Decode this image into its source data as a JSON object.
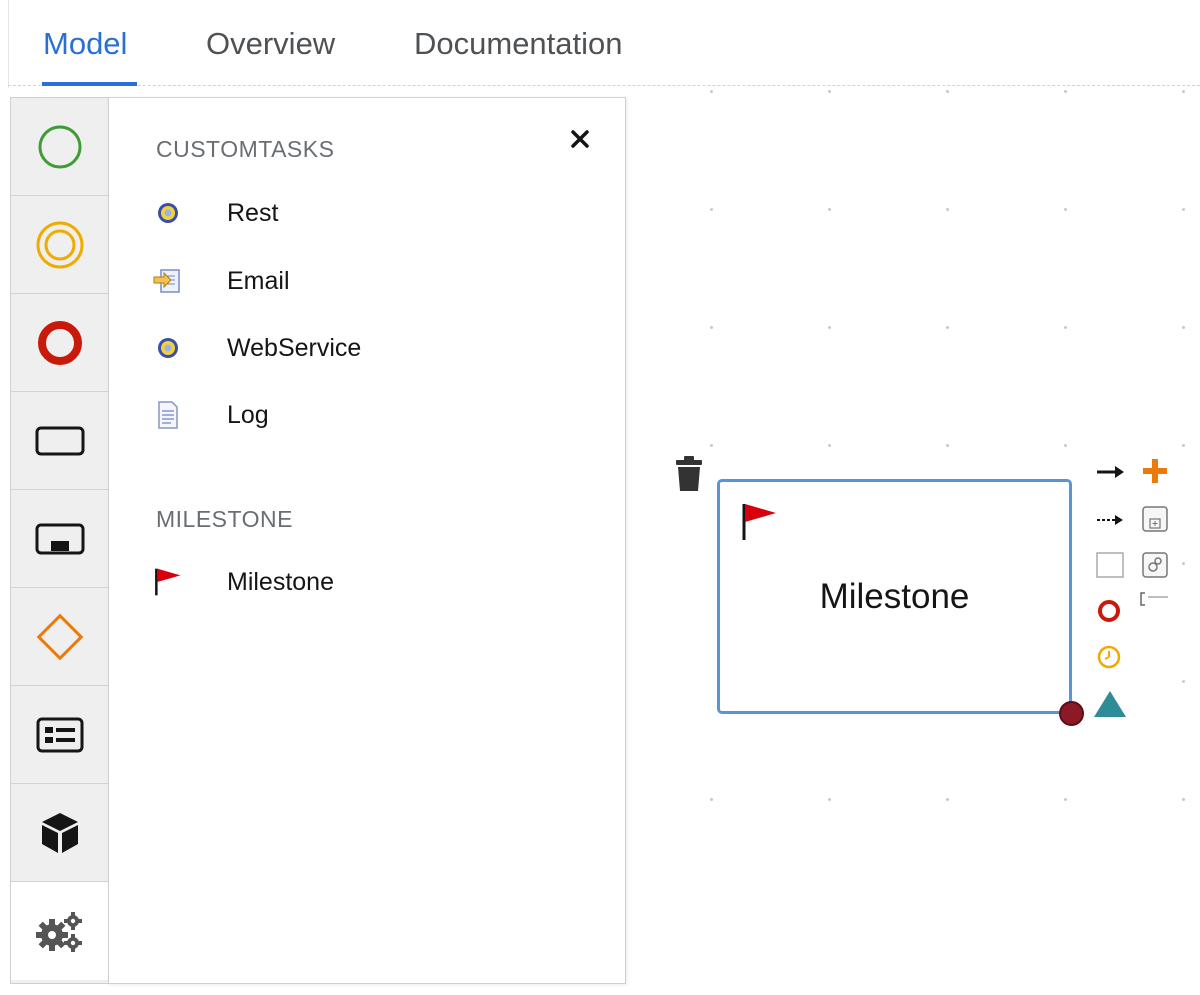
{
  "tabs": [
    {
      "label": "Model",
      "active": true
    },
    {
      "label": "Overview",
      "active": false
    },
    {
      "label": "Documentation",
      "active": false
    }
  ],
  "palette": {
    "buttons": [
      {
        "icon": "start-event-icon",
        "color": "#3f9c35"
      },
      {
        "icon": "intermediate-event-icon",
        "color": "#f0ab00"
      },
      {
        "icon": "end-event-icon",
        "color": "#c9190b"
      },
      {
        "icon": "task-icon",
        "color": "#151515"
      },
      {
        "icon": "subprocess-icon",
        "color": "#151515"
      },
      {
        "icon": "gateway-icon",
        "color": "#ec7a08"
      },
      {
        "icon": "container-icon",
        "color": "#151515"
      },
      {
        "icon": "cube-icon",
        "color": "#151515"
      },
      {
        "icon": "gears-icon",
        "color": "#151515",
        "selected": true
      }
    ]
  },
  "flyout": {
    "close_label": "×",
    "sections": [
      {
        "title": "CUSTOMTASKS",
        "items": [
          {
            "label": "Rest",
            "icon": "rest-gear-icon"
          },
          {
            "label": "Email",
            "icon": "email-icon"
          },
          {
            "label": "WebService",
            "icon": "webservice-gear-icon"
          },
          {
            "label": "Log",
            "icon": "log-document-icon"
          }
        ]
      },
      {
        "title": "MILESTONE",
        "items": [
          {
            "label": "Milestone",
            "icon": "red-flag-icon"
          }
        ]
      }
    ]
  },
  "canvas": {
    "node": {
      "label": "Milestone",
      "type": "milestone",
      "border_color": "#5b93d9"
    },
    "toolbox": [
      "sequence-flow-icon",
      "add-icon",
      "association-icon",
      "add-subprocess-icon",
      "task-icon",
      "reusable-subprocess-icon",
      "end-event-icon",
      "text-annotation-icon",
      "timer-event-icon",
      "signal-event-icon"
    ]
  },
  "colors": {
    "accent": "#2b6fd6",
    "start": "#3f9c35",
    "intermediate": "#f0ab00",
    "end": "#c9190b",
    "gateway": "#ec7a08",
    "signal": "#2e8b98"
  }
}
